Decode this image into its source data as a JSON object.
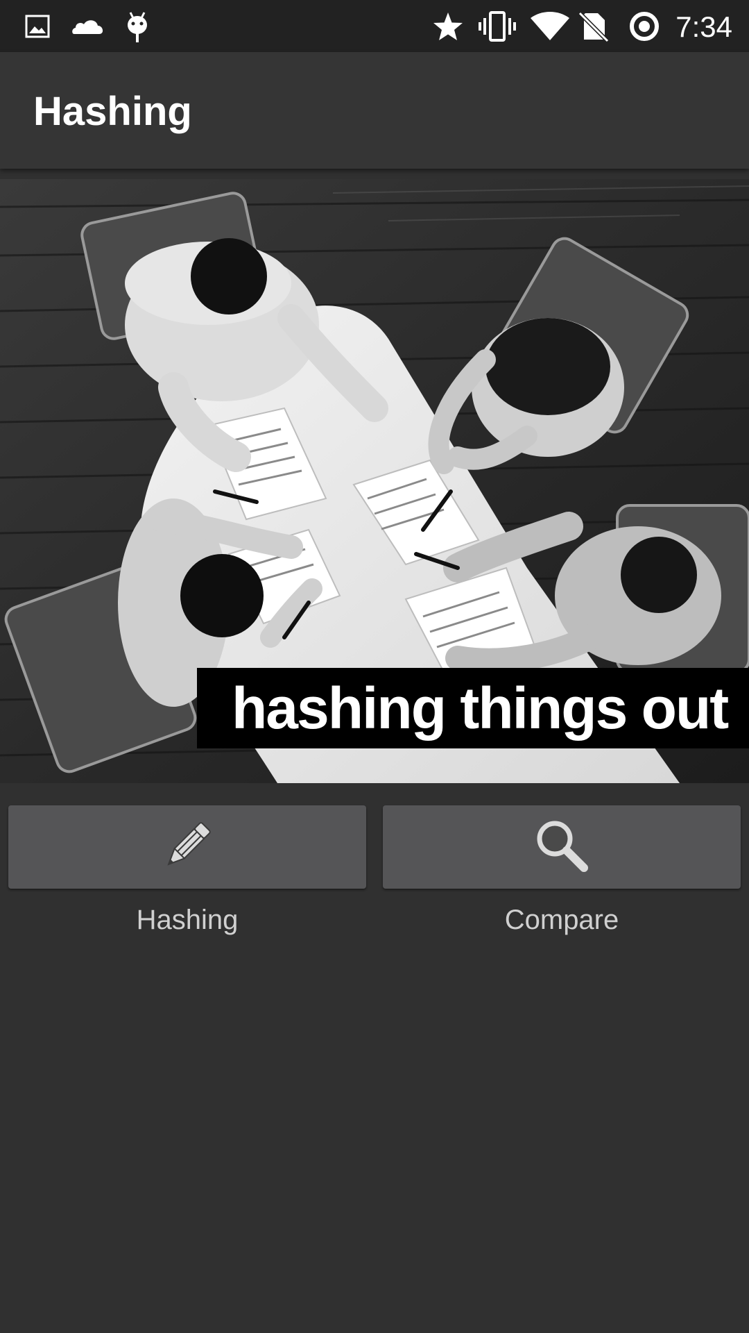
{
  "status_bar": {
    "time": "7:34",
    "icons": [
      "gallery-icon",
      "cloud-icon",
      "android-debug-icon",
      "star-icon",
      "vibrate-icon",
      "wifi-icon",
      "no-sim-icon",
      "sync-icon"
    ]
  },
  "app_bar": {
    "title": "Hashing"
  },
  "hero": {
    "caption": "hashing things out"
  },
  "actions": [
    {
      "label": "Hashing",
      "icon": "pencil-icon"
    },
    {
      "label": "Compare",
      "icon": "magnifier-icon"
    }
  ],
  "colors": {
    "background": "#303030",
    "status_bar": "#222222",
    "app_bar": "#353535",
    "button": "#555557",
    "label_text": "#d0d0d0"
  }
}
